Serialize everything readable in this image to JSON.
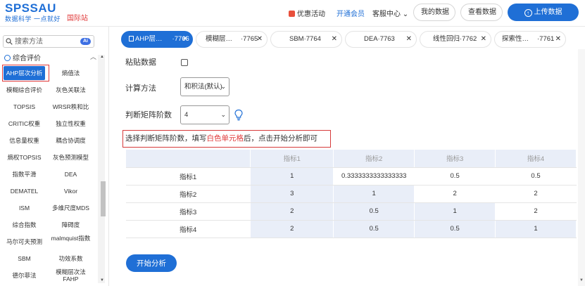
{
  "header": {
    "logo_main": "SPSSAU",
    "logo_sub": "数据科学 一点就好",
    "intl_link": "国际站",
    "promo": "优惠活动",
    "vip": "开通会员",
    "service": "客服中心",
    "my_data": "我的数据",
    "view_data": "查看数据",
    "upload": "上传数据"
  },
  "sidebar": {
    "search_placeholder": "搜索方法",
    "ai_badge": "Ai",
    "section_title": "综合评价",
    "methods": [
      "AHP层次分析",
      "熵值法",
      "模糊综合评价",
      "灰色关联法",
      "TOPSIS",
      "WRSR秩和比",
      "CRITIC权重",
      "独立性权重",
      "信息量权重",
      "耦合协调度",
      "熵权TOPSIS",
      "灰色预测模型",
      "指数平滑",
      "DEA",
      "DEMATEL",
      "Vikor",
      "ISM",
      "多维尺度MDS",
      "综合指数",
      "障碍度",
      "马尔可夫预测",
      "malmquist指数",
      "SBM",
      "功效系数",
      "德尔菲法",
      "模糊层次法FAHP"
    ]
  },
  "tabs": [
    {
      "label": "AHP层…",
      "num": "·7766"
    },
    {
      "label": "模糊层…",
      "num": "·7765"
    },
    {
      "label": "SBM",
      "num": "·7764"
    },
    {
      "label": "DEA",
      "num": "·7763"
    },
    {
      "label": "线性回归",
      "num": "·7762"
    },
    {
      "label": "探索性…",
      "num": "·7761"
    }
  ],
  "form": {
    "paste_label": "粘贴数据",
    "method_label": "计算方法",
    "method_value": "和积法(默认)",
    "order_label": "判断矩阵阶数",
    "order_value": "4",
    "hint_pre": "选择判断矩阵阶数，填写",
    "hint_highlight": "白色单元格",
    "hint_post": "后，点击开始分析即可"
  },
  "matrix": {
    "headers": [
      "指标1",
      "指标2",
      "指标3",
      "指标4"
    ],
    "rows": [
      {
        "name": "指标1",
        "values": [
          "1",
          "0.3333333333333333",
          "0.5",
          "0.5"
        ]
      },
      {
        "name": "指标2",
        "values": [
          "3",
          "1",
          "2",
          "2"
        ]
      },
      {
        "name": "指标3",
        "values": [
          "2",
          "0.5",
          "1",
          "2"
        ]
      },
      {
        "name": "指标4",
        "values": [
          "2",
          "0.5",
          "0.5",
          "1"
        ]
      }
    ]
  },
  "start_button": "开始分析",
  "colors": {
    "primary": "#1f6fd6",
    "highlight": "#e03b3b",
    "table_gray": "#e9eef8"
  }
}
